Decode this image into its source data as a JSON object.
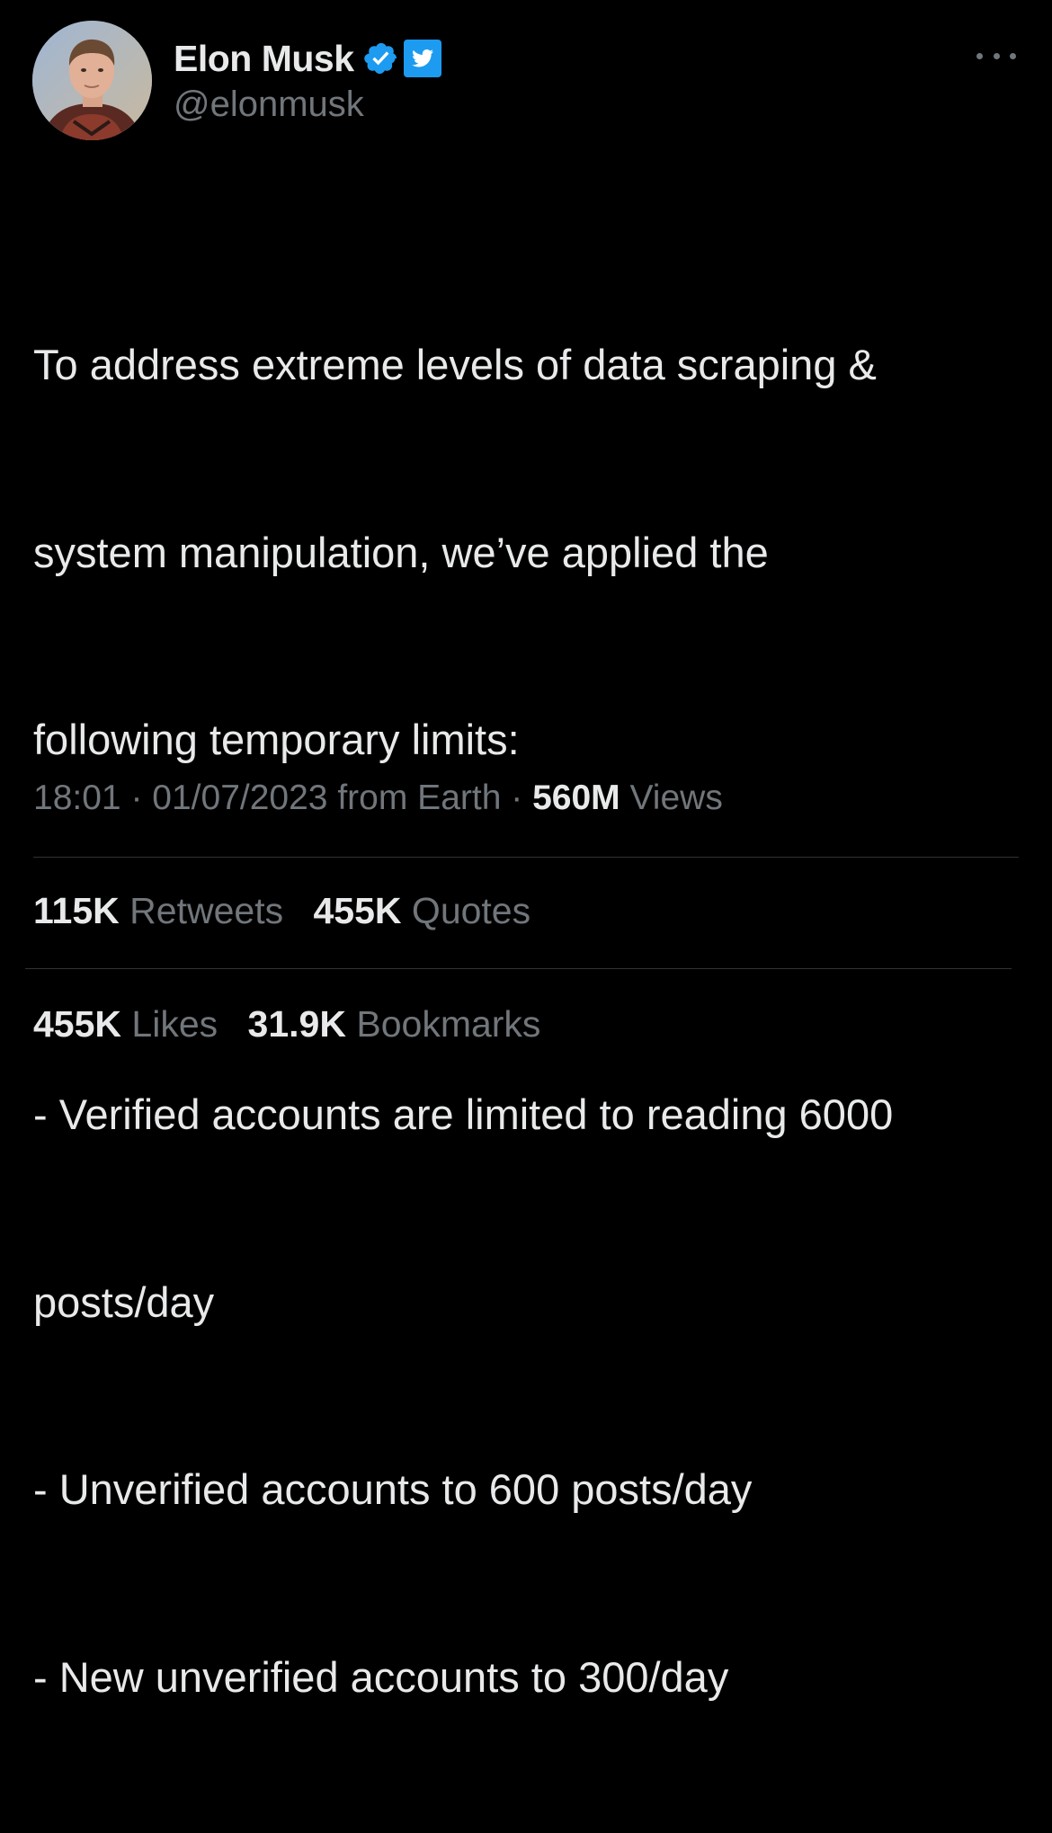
{
  "author": {
    "display_name": "Elon Musk",
    "handle": "@elonmusk",
    "verified_badge": "verified-badge-icon",
    "affiliation_badge": "twitter-bird-icon"
  },
  "tweet": {
    "lines": [
      "To address extreme levels of data scraping &",
      "system manipulation, we’ve applied the",
      "following temporary limits:",
      "",
      "- Verified accounts are limited to reading 6000",
      "posts/day",
      "- Unverified accounts to 600 posts/day",
      "- New unverified accounts to 300/day"
    ]
  },
  "meta": {
    "time": "18:01",
    "separator": "·",
    "date": "01/07/2023",
    "source": "from Earth",
    "views_count": "560M",
    "views_label": "Views"
  },
  "stats": {
    "retweets_count": "115K",
    "retweets_label": "Retweets",
    "quotes_count": "455K",
    "quotes_label": "Quotes",
    "likes_count": "455K",
    "likes_label": "Likes",
    "bookmarks_count": "31.9K",
    "bookmarks_label": "Bookmarks"
  },
  "colors": {
    "background": "#000000",
    "primary_text": "#e7e9ea",
    "secondary_text": "#71767b",
    "divider": "#2f3336",
    "verified_blue": "#1d9bf0"
  }
}
